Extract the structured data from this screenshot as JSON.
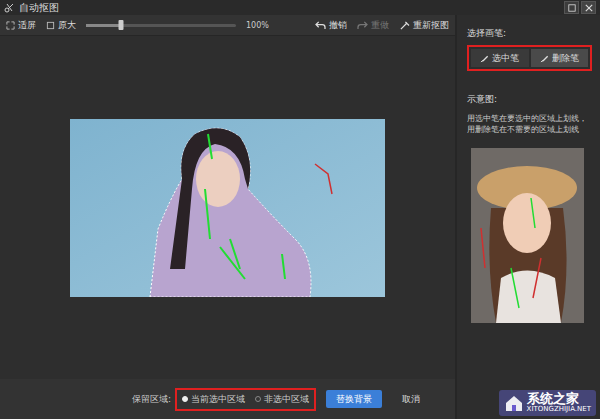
{
  "window": {
    "title": "自动抠图"
  },
  "toolbar": {
    "fit": "适屏",
    "original": "原大",
    "zoom": {
      "level": 0.23,
      "reading": "100%"
    },
    "undo": {
      "label": "撤销",
      "disabled": false
    },
    "redo": {
      "label": "重做",
      "disabled": true
    },
    "reset": "重新抠图"
  },
  "brush_panel": {
    "title": "选择画笔:",
    "brushes": [
      {
        "label": "选中笔",
        "selected": false
      },
      {
        "label": "删除笔",
        "selected": true
      }
    ]
  },
  "preview": {
    "title": "示意图:",
    "hint": "用选中笔在要选中的区域上划线，用删除笔在不需要的区域上划线"
  },
  "bottom_bar": {
    "keep_label": "保留区域:",
    "options": [
      {
        "label": "当前选中区域",
        "selected": true
      },
      {
        "label": "非选中区域",
        "selected": false
      }
    ],
    "buttons": [
      {
        "label": "替换背景",
        "primary": true
      },
      {
        "label": "取消",
        "primary": false
      }
    ]
  },
  "watermark": {
    "name": "系统之家",
    "url": "XITONGZHIJIA.NET"
  }
}
